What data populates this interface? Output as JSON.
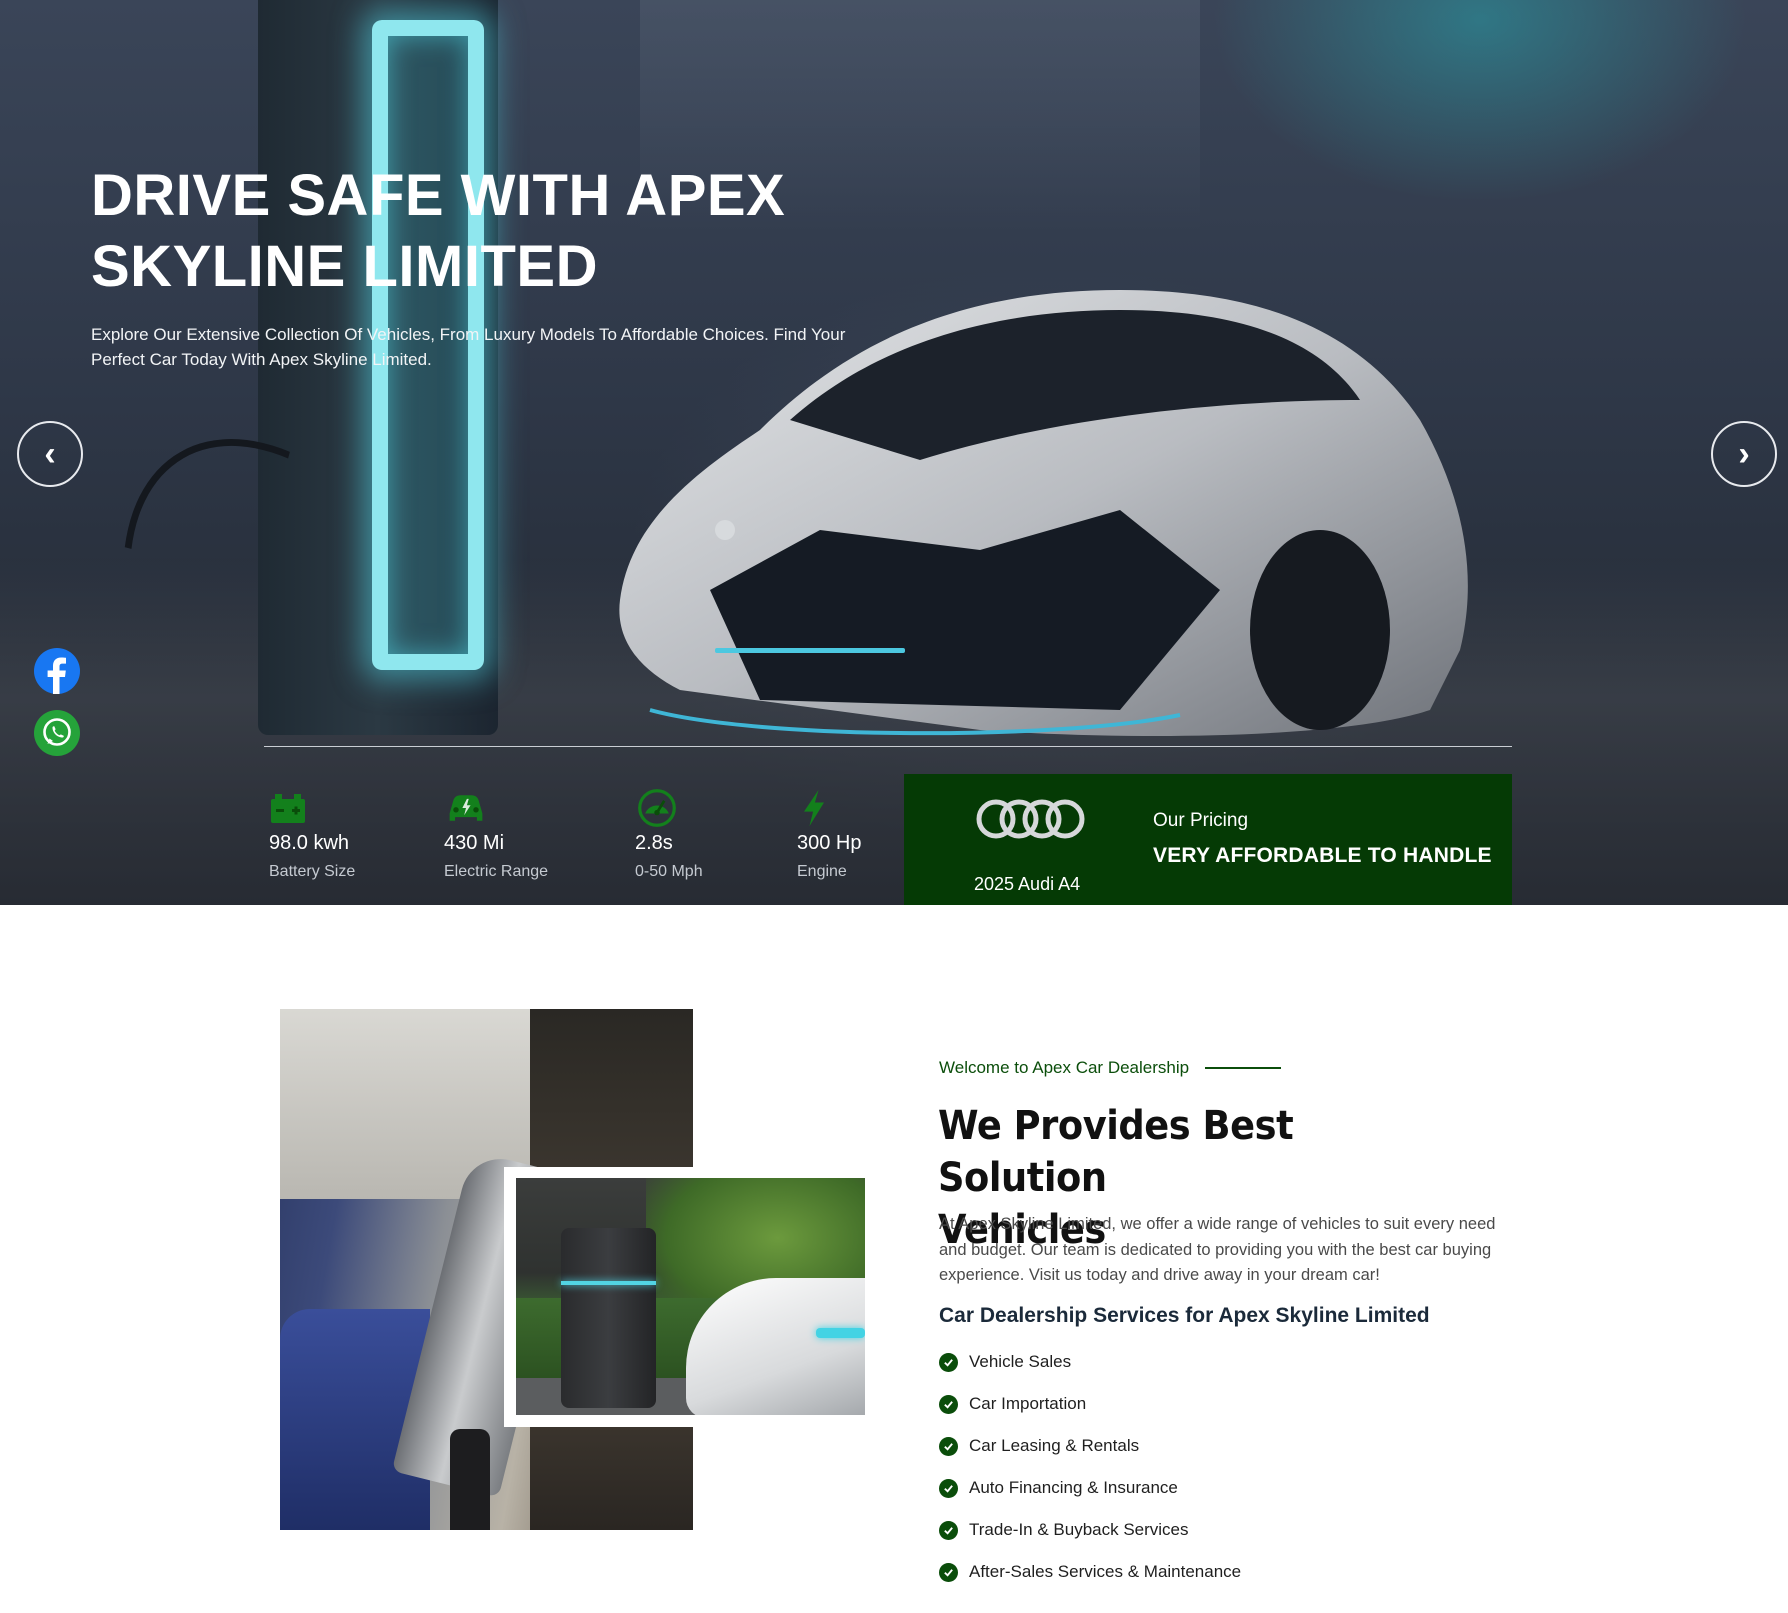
{
  "hero": {
    "title_line1": "DRIVE SAFE WITH APEX",
    "title_line2": "SKYLINE LIMITED",
    "subtitle": "Explore Our Extensive Collection Of Vehicles, From Luxury Models To Affordable Choices. Find Your Perfect Car Today With Apex Skyline Limited.",
    "prev_icon": "chevron-left-icon",
    "prev_glyph": "‹",
    "next_icon": "chevron-right-icon",
    "next_glyph": "›",
    "social": [
      {
        "name": "facebook-icon",
        "color": "#1877f2"
      },
      {
        "name": "whatsapp-icon",
        "color": "#25a33a"
      }
    ],
    "stats": [
      {
        "icon": "battery-icon",
        "value": "98.0 kwh",
        "label": "Battery Size"
      },
      {
        "icon": "car-icon",
        "value": "430 Mi",
        "label": "Electric Range"
      },
      {
        "icon": "speedometer-icon",
        "value": "2.8s",
        "label": "0-50 Mph"
      },
      {
        "icon": "lightning-icon",
        "value": "300 Hp",
        "label": "Engine"
      }
    ],
    "stat_icon_color": "#13801c",
    "pricing": {
      "logo": "audi-rings-logo",
      "model": "2025 Audi A4",
      "label": "Our Pricing",
      "value": "VERY AFFORDABLE TO HANDLE",
      "background": "#053a05"
    }
  },
  "about": {
    "eyebrow": "Welcome to Apex Car Dealership",
    "title_line1": "We Provides Best Solution",
    "title_line2": "Vehicles",
    "description": "At Apex Skyline Limited, we offer a wide range of vehicles to suit every need and budget. Our team is dedicated to providing you with the best car buying experience. Visit us today and drive away in your dream car!",
    "services_title": "Car Dealership Services for Apex Skyline Limited",
    "services": [
      "Vehicle Sales",
      "Car Importation",
      "Car Leasing & Rentals",
      "Auto Financing & Insurance",
      "Trade-In & Buyback Services",
      "After-Sales Services & Maintenance"
    ],
    "accent_color": "#0a4d0a"
  }
}
